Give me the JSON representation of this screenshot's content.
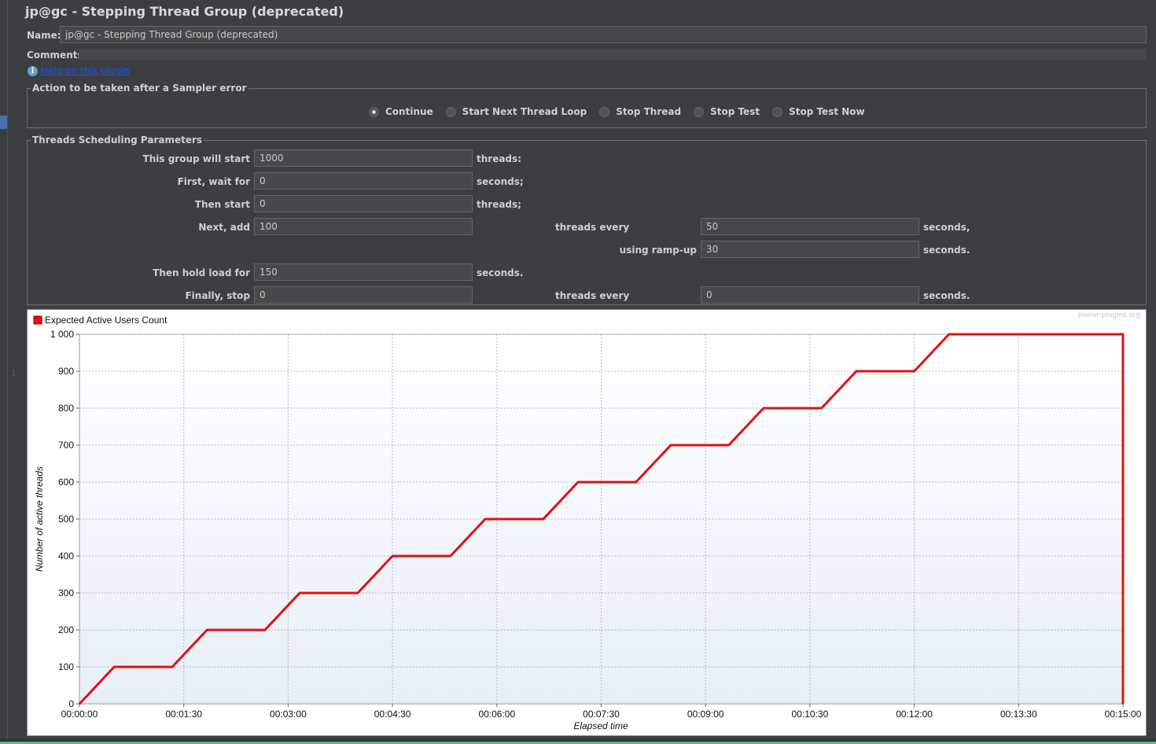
{
  "title": "jp@gc - Stepping Thread Group (deprecated)",
  "name": {
    "label": "Name:",
    "value": "jp@gc - Stepping Thread Group (deprecated)"
  },
  "comments": {
    "label": "Comments:",
    "value": ""
  },
  "help": {
    "icon": "info-icon",
    "link_text": "Help on this plugin"
  },
  "sampler_error": {
    "legend": "Action to be taken after a Sampler error",
    "options": [
      "Continue",
      "Start Next Thread Loop",
      "Stop Thread",
      "Stop Test",
      "Stop Test Now"
    ],
    "selected": "Continue"
  },
  "scheduling": {
    "legend": "Threads Scheduling Parameters",
    "group_start_label": "This group will start",
    "group_start_value": "1000",
    "group_start_unit": "threads:",
    "wait_label": "First, wait for",
    "wait_value": "0",
    "wait_unit": "seconds;",
    "then_start_label": "Then start",
    "then_start_value": "0",
    "then_start_unit": "threads;",
    "next_add_label": "Next, add",
    "next_add_value": "100",
    "threads_every_label": "threads every",
    "next_add_every_value": "50",
    "next_add_every_unit": "seconds,",
    "rampup_label": "using ramp-up",
    "rampup_value": "30",
    "rampup_unit": "seconds.",
    "hold_label": "Then hold load for",
    "hold_value": "150",
    "hold_unit": "seconds.",
    "stop_label": "Finally, stop",
    "stop_value": "0",
    "stop_every_label": "threads every",
    "stop_every_value": "0",
    "stop_every_unit": "seconds."
  },
  "chart_data": {
    "type": "line",
    "watermark": "jmeter-plugins.org",
    "xlabel": "Elapsed time",
    "ylabel": "Number of active threads",
    "legend_position": "top-left",
    "grid": true,
    "xlim": [
      0,
      900
    ],
    "ylim": [
      0,
      1000
    ],
    "y_ticks": [
      0,
      100,
      200,
      300,
      400,
      500,
      600,
      700,
      800,
      900,
      1000
    ],
    "y_tick_labels": [
      "0",
      "100",
      "200",
      "300",
      "400",
      "500",
      "600",
      "700",
      "800",
      "900",
      "1 000"
    ],
    "x_ticks": [
      0,
      90,
      180,
      270,
      360,
      450,
      540,
      630,
      720,
      810,
      900
    ],
    "x_tick_labels": [
      "00:00:00",
      "00:01:30",
      "00:03:00",
      "00:04:30",
      "00:06:00",
      "00:07:30",
      "00:09:00",
      "00:10:30",
      "00:12:00",
      "00:13:30",
      "00:15:00"
    ],
    "series": [
      {
        "name": "Expected Active Users Count",
        "color": "#e01010",
        "x": [
          0,
          30,
          80,
          110,
          160,
          190,
          240,
          270,
          320,
          350,
          400,
          430,
          480,
          510,
          560,
          590,
          640,
          670,
          720,
          750,
          900,
          900
        ],
        "y": [
          0,
          100,
          100,
          200,
          200,
          300,
          300,
          400,
          400,
          500,
          500,
          600,
          600,
          700,
          700,
          800,
          800,
          900,
          900,
          1000,
          1000,
          0
        ]
      }
    ]
  }
}
